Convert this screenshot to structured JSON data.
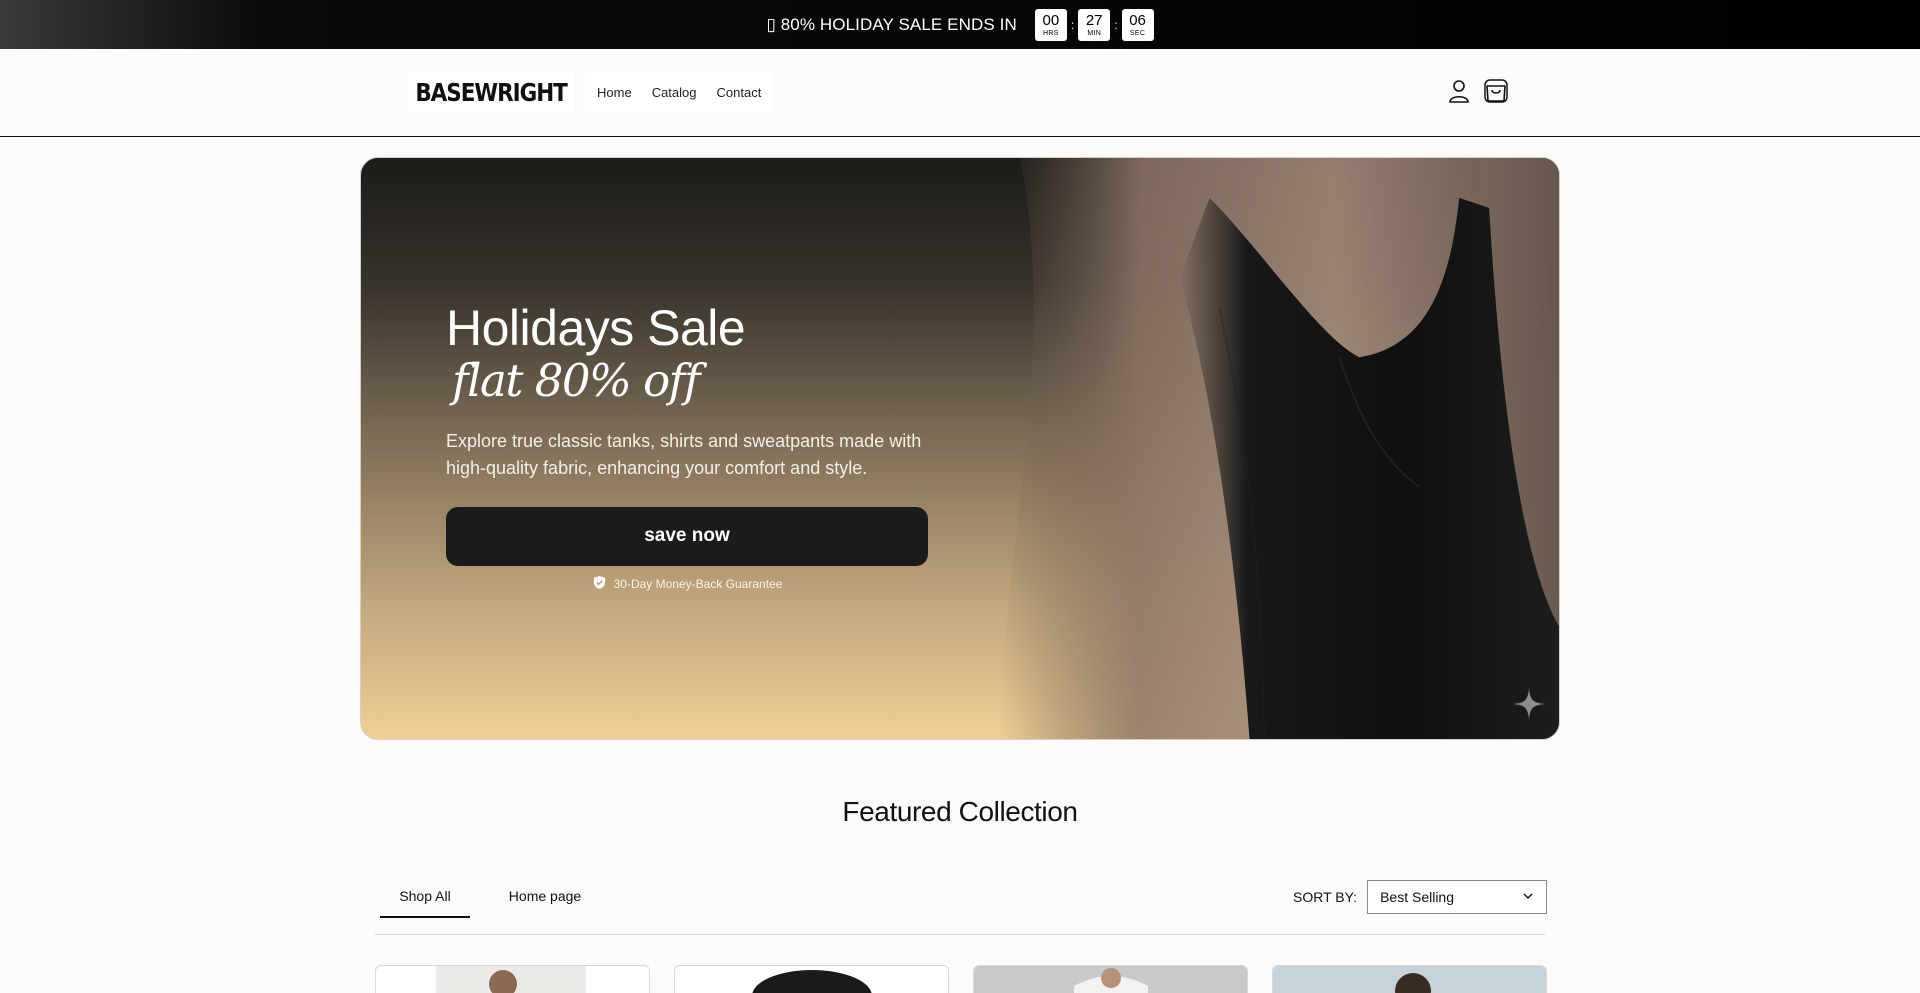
{
  "announcement": {
    "icon": "tag-icon",
    "text": "80% HOLIDAY SALE ENDS IN",
    "countdown": [
      {
        "value": "00",
        "unit": "HRS"
      },
      {
        "value": "27",
        "unit": "MIN"
      },
      {
        "value": "06",
        "unit": "SEC"
      }
    ],
    "separator": ":"
  },
  "header": {
    "logo": "BASEWRIGHT",
    "nav": [
      "Home",
      "Catalog",
      "Contact"
    ],
    "icons": [
      "account-icon",
      "cart-icon"
    ]
  },
  "hero": {
    "title": "Holidays Sale",
    "subtitle": "flat 80% off",
    "description": "Explore true classic tanks, shirts and sweatpants made with high-quality fabric, enhancing your comfort and style.",
    "button": "save now",
    "guarantee": "30-Day Money-Back Guarantee",
    "colors": {
      "button": "#1b1b1b",
      "gradient_bottom": "#f0cf96"
    }
  },
  "featured": {
    "title": "Featured Collection",
    "tabs": [
      "Shop All",
      "Home page"
    ],
    "active_tab": "Shop All",
    "sort_label": "SORT BY:",
    "sort_value": "Best Selling"
  }
}
